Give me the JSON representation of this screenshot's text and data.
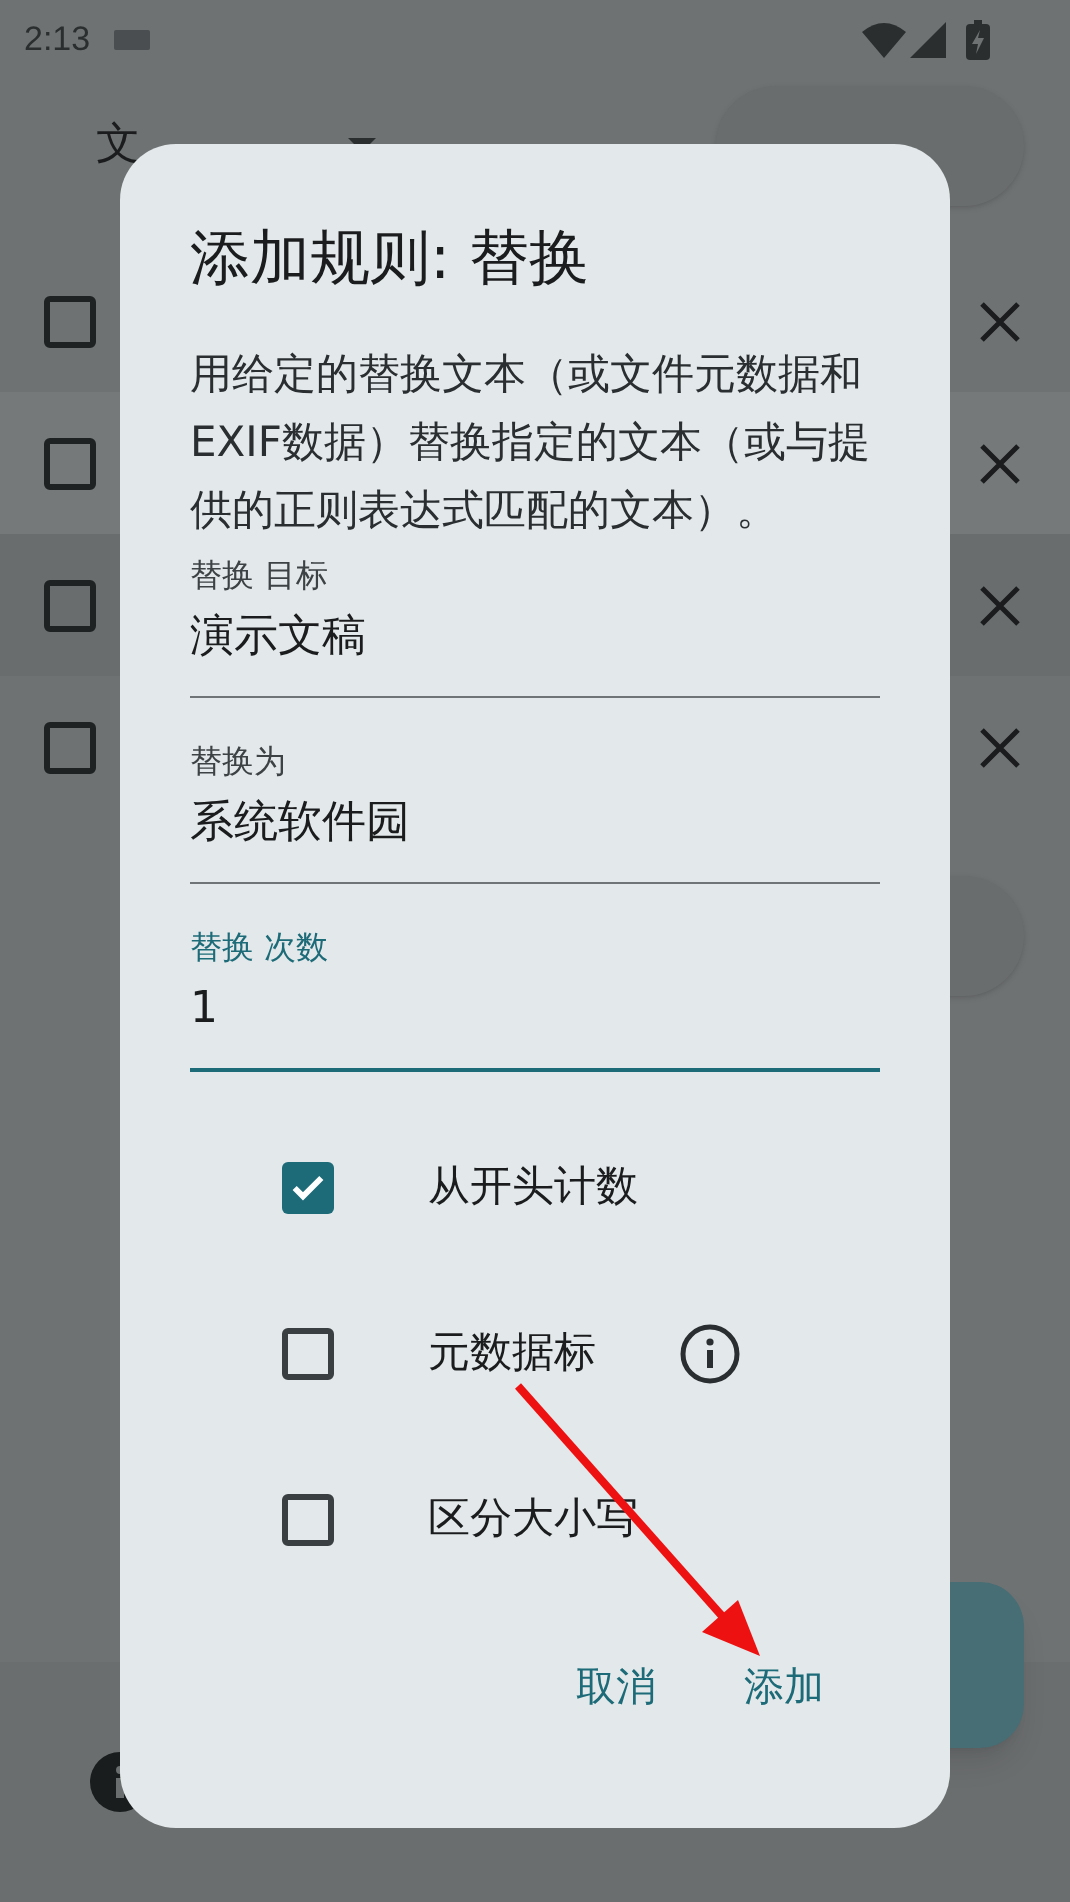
{
  "status_bar": {
    "time": "2:13"
  },
  "app_bar": {
    "file_dropdown": "文"
  },
  "file_rows": [
    {
      "checked": false
    },
    {
      "checked": false
    },
    {
      "checked": false
    },
    {
      "checked": false
    }
  ],
  "dialog": {
    "title": "添加规则: 替换",
    "description": "用给定的替换文本（或文件元数据和EXIF数据）替换指定的文本（或与提供的正则表达式匹配的文本）。",
    "fields": [
      {
        "label": "替换 目标",
        "value": "演示文稿",
        "focused": false
      },
      {
        "label": "替换为",
        "value": "系统软件园",
        "focused": false
      },
      {
        "label": "替换 次数",
        "value": "1",
        "focused": true
      }
    ],
    "options": [
      {
        "label": "从开头计数",
        "checked": true,
        "info": false
      },
      {
        "label": "元数据标",
        "checked": false,
        "info": true
      },
      {
        "label": "区分大小写",
        "checked": false,
        "info": false
      }
    ],
    "buttons": [
      "取消",
      "添加"
    ]
  }
}
